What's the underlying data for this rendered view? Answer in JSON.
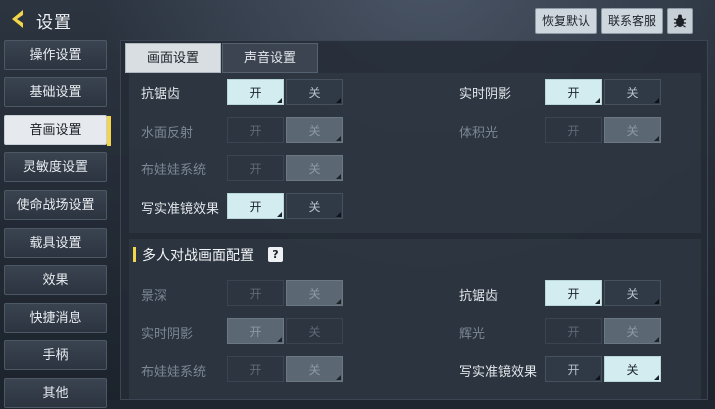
{
  "header": {
    "title": "设置",
    "restore_label": "恢复默认",
    "service_label": "联系客服"
  },
  "sidebar": {
    "items": [
      {
        "label": "操作设置"
      },
      {
        "label": "基础设置"
      },
      {
        "label": "音画设置",
        "active": true
      },
      {
        "label": "灵敏度设置"
      },
      {
        "label": "使命战场设置"
      },
      {
        "label": "载具设置"
      },
      {
        "label": "效果"
      },
      {
        "label": "快捷消息"
      },
      {
        "label": "手柄"
      },
      {
        "label": "其他"
      }
    ]
  },
  "tabs": [
    {
      "label": "画面设置",
      "active": true
    },
    {
      "label": "声音设置",
      "active": false
    }
  ],
  "section1": {
    "rows": [
      {
        "label": "抗锯齿",
        "on": "开",
        "off": "关",
        "value": "开",
        "enabled": true
      },
      {
        "label": "水面反射",
        "on": "开",
        "off": "关",
        "value": "关",
        "enabled": false
      },
      {
        "label": "布娃娃系统",
        "on": "开",
        "off": "关",
        "value": "关",
        "enabled": false
      },
      {
        "label": "写实准镜效果",
        "on": "开",
        "off": "关",
        "value": "开",
        "enabled": true
      },
      {
        "label": "实时阴影",
        "on": "开",
        "off": "关",
        "value": "开",
        "enabled": true
      },
      {
        "label": "体积光",
        "on": "开",
        "off": "关",
        "value": "关",
        "enabled": false
      }
    ]
  },
  "section2": {
    "title": "多人对战画面配置",
    "help_glyph": "?",
    "rows": [
      {
        "label": "景深",
        "on": "开",
        "off": "关",
        "value": "关",
        "enabled": false
      },
      {
        "label": "实时阴影",
        "on": "开",
        "off": "关",
        "value": "开",
        "enabled": false
      },
      {
        "label": "布娃娃系统",
        "on": "开",
        "off": "关",
        "value": "关",
        "enabled": false
      },
      {
        "label": "抗锯齿",
        "on": "开",
        "off": "关",
        "value": "开",
        "enabled": true
      },
      {
        "label": "辉光",
        "on": "开",
        "off": "关",
        "value": "关",
        "enabled": false
      },
      {
        "label": "写实准镜效果",
        "on": "开",
        "off": "关",
        "value": "关",
        "enabled": true
      }
    ]
  },
  "colors": {
    "accent": "#f2d54b",
    "selected_option": "#d2ecef",
    "panel_bg": "#242c36"
  }
}
